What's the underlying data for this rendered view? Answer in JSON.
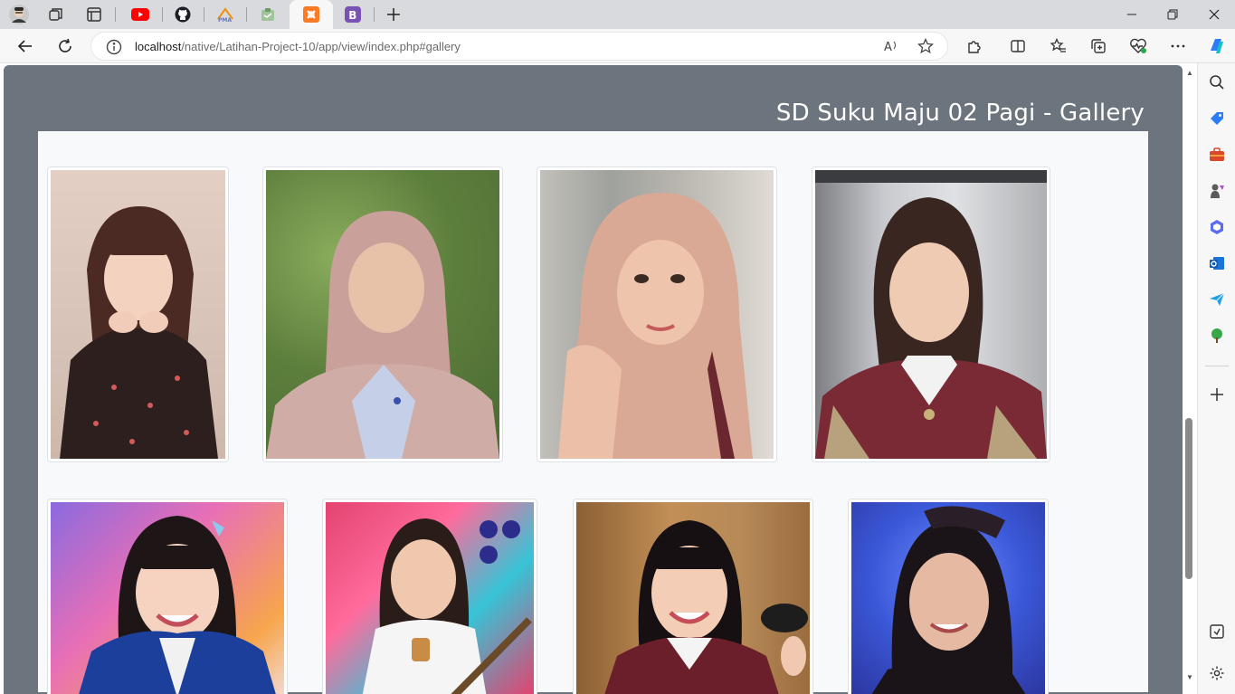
{
  "browser": {
    "tabs": [
      {
        "name": "profile-avatar",
        "title": ""
      },
      {
        "name": "workspaces",
        "title": ""
      },
      {
        "name": "tab-actions",
        "title": ""
      },
      {
        "name": "youtube",
        "title": ""
      },
      {
        "name": "github",
        "title": ""
      },
      {
        "name": "phpmyadmin",
        "title": ""
      },
      {
        "name": "app-tab",
        "title": ""
      },
      {
        "name": "xampp",
        "title": ""
      },
      {
        "name": "bootstrap",
        "title": ""
      }
    ],
    "url_host": "localhost",
    "url_path": "/native/Latihan-Project-10/app/view/index.php#gallery",
    "colors": {
      "youtube": "#ff0000",
      "bootstrap": "#7952b3",
      "xampp": "#fb7a24",
      "accent": "#0078d4"
    }
  },
  "page": {
    "title": "SD Suku Maju 02 Pagi - Gallery",
    "colors": {
      "header_bg": "#6c757d",
      "gallery_bg": "#f8f9fa"
    }
  },
  "gallery": {
    "photos": [
      {
        "name": "gallery-photo-1",
        "colors": [
          "#d9c6bc",
          "#2b1d1a"
        ]
      },
      {
        "name": "gallery-photo-2",
        "colors": [
          "#6f8f4a",
          "#c9a4a0"
        ]
      },
      {
        "name": "gallery-photo-3",
        "colors": [
          "#b8b4ae",
          "#d9a68f"
        ]
      },
      {
        "name": "gallery-photo-4",
        "colors": [
          "#c7c9cc",
          "#7a2a35"
        ]
      },
      {
        "name": "gallery-photo-5",
        "colors": [
          "#e88bc4",
          "#1c3f9c"
        ]
      },
      {
        "name": "gallery-photo-6",
        "colors": [
          "#e04c7f",
          "#f1f1f1"
        ]
      },
      {
        "name": "gallery-photo-7",
        "colors": [
          "#b88a55",
          "#6b1f2b"
        ]
      },
      {
        "name": "gallery-photo-8",
        "colors": [
          "#3b58d8",
          "#c49a8c"
        ]
      }
    ]
  }
}
